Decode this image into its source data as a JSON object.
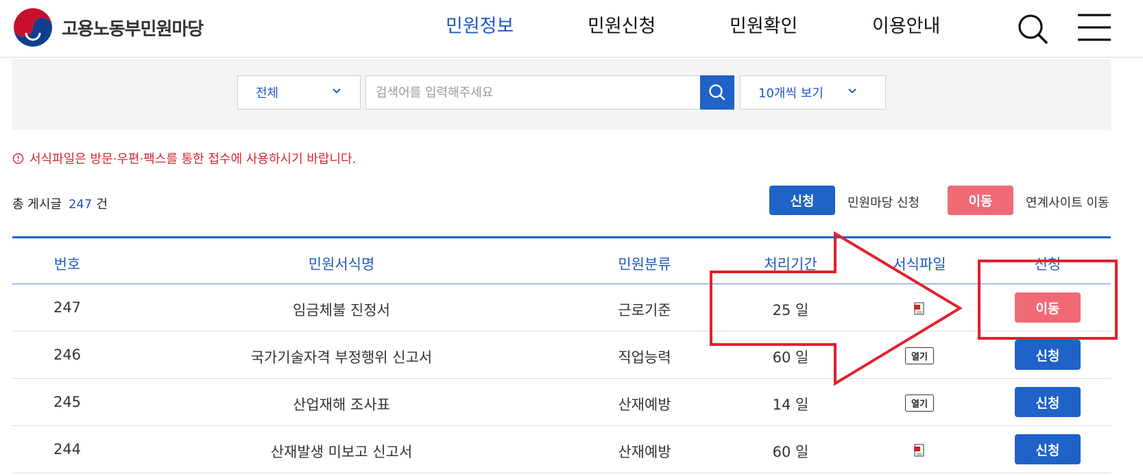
{
  "header": {
    "logo_text": "고용노동부민원마당",
    "nav": [
      {
        "label": "민원정보",
        "active": true
      },
      {
        "label": "민원신청",
        "active": false
      },
      {
        "label": "민원확인",
        "active": false
      },
      {
        "label": "이용안내",
        "active": false
      }
    ],
    "search_icon": "search-icon",
    "menu_icon": "hamburger-menu-icon"
  },
  "search": {
    "category_selected": "전체",
    "placeholder": "검색어를 입력해주세요",
    "page_size_selected": "10개씩 보기"
  },
  "notice": {
    "text": "서식파일은 방문·우편·팩스를 통한 접수에 사용하시기 바랍니다."
  },
  "summary": {
    "prefix": "총 게시글",
    "count": "247",
    "suffix": "건"
  },
  "legend": {
    "apply_badge": "신청",
    "apply_text": "민원마당 신청",
    "move_badge": "이동",
    "move_text": "연계사이트 이동"
  },
  "table": {
    "headers": [
      "번호",
      "민원서식명",
      "민원분류",
      "처리기간",
      "서식파일",
      "신청"
    ],
    "rows": [
      {
        "no": "247",
        "name": "임금체불 진정서",
        "category": "근로기준",
        "period": "25 일",
        "file": "document-icon",
        "action": "이동",
        "action_type": "move"
      },
      {
        "no": "246",
        "name": "국가기술자격 부정행위 신고서",
        "category": "직업능력",
        "period": "60 일",
        "file": "열기",
        "action": "신청",
        "action_type": "apply"
      },
      {
        "no": "245",
        "name": "산업재해 조사표",
        "category": "산재예방",
        "period": "14 일",
        "file": "열기",
        "action": "신청",
        "action_type": "apply"
      },
      {
        "no": "244",
        "name": "산재발생 미보고 신고서",
        "category": "산재예방",
        "period": "60 일",
        "file": "document-icon",
        "action": "신청",
        "action_type": "apply"
      }
    ]
  },
  "colors": {
    "primary": "#1f62c8",
    "pink": "#ef6a74",
    "notice_red": "#d8232a",
    "annotation_red": "#e3202a"
  }
}
